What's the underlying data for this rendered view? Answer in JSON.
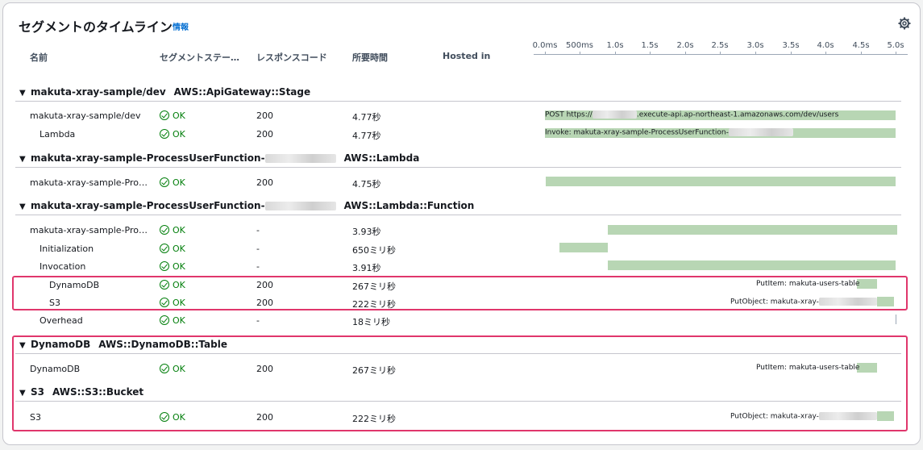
{
  "panel": {
    "title": "セグメントのタイムライン",
    "info": "情報",
    "settings_icon": "gear-icon"
  },
  "columns": {
    "name": "名前",
    "status": "セグメントステー…",
    "response": "レスポンスコード",
    "duration": "所要時間",
    "hosted": "Hosted in"
  },
  "axis_ticks": [
    "0.0ms",
    "500ms",
    "1.0s",
    "1.5s",
    "2.0s",
    "2.5s",
    "3.0s",
    "3.5s",
    "4.0s",
    "4.5s",
    "5.0s"
  ],
  "groups": [
    {
      "name": "makuta-xray-sample/dev",
      "type": "AWS::ApiGateway::Stage",
      "redacted": false
    },
    {
      "name": "makuta-xray-sample-ProcessUserFunction-",
      "type": "AWS::Lambda",
      "redacted": true
    },
    {
      "name": "makuta-xray-sample-ProcessUserFunction-",
      "type": "AWS::Lambda::Function",
      "redacted": true
    },
    {
      "name": "DynamoDB",
      "type": "AWS::DynamoDB::Table",
      "redacted": false
    },
    {
      "name": "S3",
      "type": "AWS::S3::Bucket",
      "redacted": false
    }
  ],
  "rows": [
    {
      "name": "makuta-xray-sample/dev",
      "status": "OK",
      "code": "200",
      "duration": "4.77秒",
      "bar_label": "POST https://",
      "bar_label2": ".execute-api.ap-northeast-1.amazonaws.com/dev/users"
    },
    {
      "name": "Lambda",
      "status": "OK",
      "code": "200",
      "duration": "4.77秒",
      "bar_label": "Invoke: makuta-xray-sample-ProcessUserFunction-"
    },
    {
      "name": "makuta-xray-sample-Pro…",
      "status": "OK",
      "code": "200",
      "duration": "4.75秒"
    },
    {
      "name": "makuta-xray-sample-Pro…",
      "status": "OK",
      "code": "-",
      "duration": "3.93秒"
    },
    {
      "name": "Initialization",
      "status": "OK",
      "code": "-",
      "duration": "650ミリ秒"
    },
    {
      "name": "Invocation",
      "status": "OK",
      "code": "-",
      "duration": "3.91秒"
    },
    {
      "name": "DynamoDB",
      "status": "OK",
      "code": "200",
      "duration": "267ミリ秒",
      "bar_label": "PutItem: makuta-users-table"
    },
    {
      "name": "S3",
      "status": "OK",
      "code": "200",
      "duration": "222ミリ秒",
      "bar_label": "PutObject: makuta-xray-"
    },
    {
      "name": "Overhead",
      "status": "OK",
      "code": "-",
      "duration": "18ミリ秒"
    },
    {
      "name": "DynamoDB",
      "status": "OK",
      "code": "200",
      "duration": "267ミリ秒",
      "bar_label": "PutItem: makuta-users-table"
    },
    {
      "name": "S3",
      "status": "OK",
      "code": "200",
      "duration": "222ミリ秒",
      "bar_label": "PutObject: makuta-xray-"
    }
  ],
  "colors": {
    "ok": "#037f0c",
    "bar": "#b8d6b4",
    "highlight": "#e0366c",
    "link": "#0972d3"
  }
}
